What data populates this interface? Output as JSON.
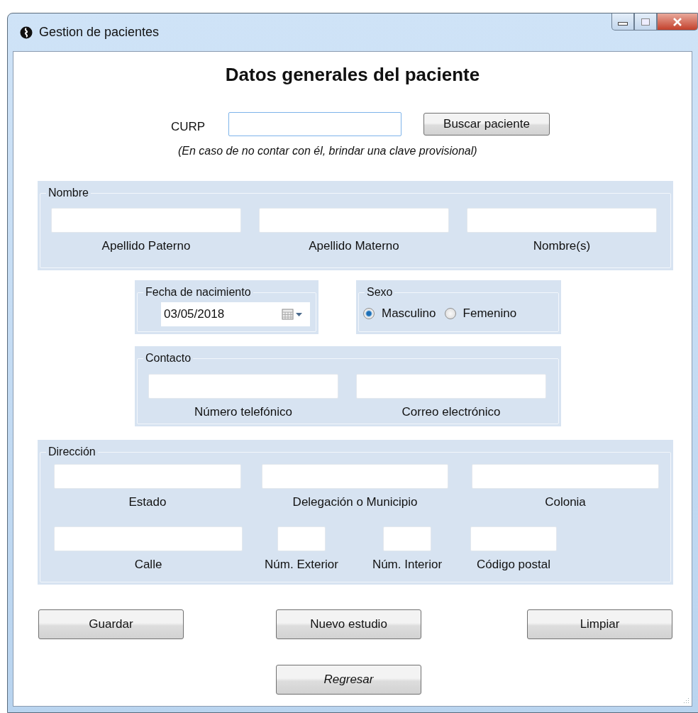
{
  "window": {
    "title": "Gestion de pacientes"
  },
  "heading": "Datos generales del paciente",
  "curp": {
    "label": "CURP",
    "button": "Buscar paciente",
    "hint": "(En caso de no contar con él, brindar una clave provisional)"
  },
  "nombre": {
    "legend": "Nombre",
    "fields": [
      "Apellido Paterno",
      "Apellido Materno",
      "Nombre(s)"
    ]
  },
  "fecha": {
    "legend": "Fecha de nacimiento",
    "value": "03/05/2018"
  },
  "sexo": {
    "legend": "Sexo",
    "options": [
      {
        "label": "Masculino",
        "selected": true
      },
      {
        "label": "Femenino",
        "selected": false
      }
    ]
  },
  "contacto": {
    "legend": "Contacto",
    "fields": [
      "Número telefónico",
      "Correo electrónico"
    ]
  },
  "direccion": {
    "legend": "Dirección",
    "fields": [
      "Estado",
      "Delegación o Municipio",
      "Colonia",
      "Calle",
      "Núm. Exterior",
      "Núm. Interior",
      "Código postal"
    ]
  },
  "buttons": [
    "Guardar",
    "Nuevo estudio",
    "Limpiar"
  ],
  "back_button": "Regresar"
}
